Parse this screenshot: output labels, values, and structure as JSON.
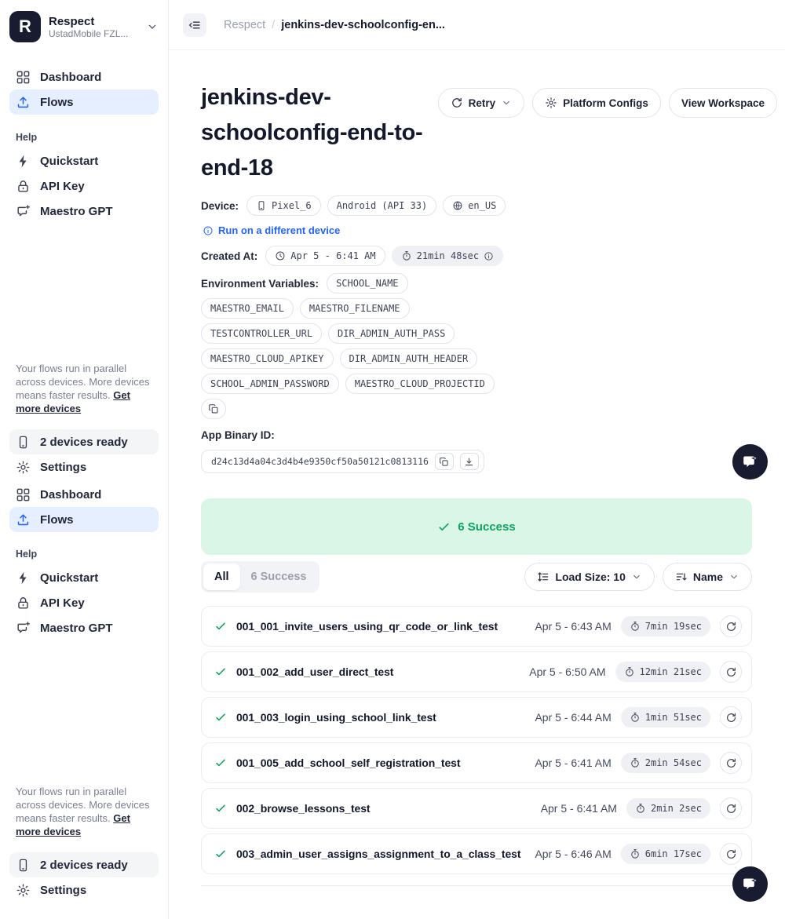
{
  "workspace": {
    "logo_letter": "R",
    "name": "Respect",
    "org": "UstadMobile FZL..."
  },
  "sidebar": {
    "dashboard": "Dashboard",
    "flows": "Flows",
    "help_label": "Help",
    "quickstart": "Quickstart",
    "api_key": "API Key",
    "maestro_gpt": "Maestro GPT",
    "promo_text": "Your flows run in parallel across devices. More devices means faster results.",
    "promo_link": "Get more devices",
    "devices_ready": "2 devices ready",
    "settings": "Settings"
  },
  "topbar": {
    "breadcrumb_root": "Respect",
    "breadcrumb_sep": "/",
    "breadcrumb_current": "jenkins-dev-schoolconfig-en..."
  },
  "header": {
    "title": "jenkins-dev-schoolconfig-end-to-end-18",
    "retry_label": "Retry",
    "platform_configs_label": "Platform Configs",
    "view_workspace_label": "View Workspace"
  },
  "details": {
    "device_label": "Device:",
    "device_model": "Pixel_6",
    "device_os": "Android (API 33)",
    "device_locale": "en_US",
    "run_different_device": "Run on a different device",
    "created_label": "Created At:",
    "created_time": "Apr 5 - 6:41 AM",
    "total_duration": "21min 48sec",
    "env_label": "Environment Variables:",
    "env_vars": [
      "SCHOOL_NAME",
      "MAESTRO_EMAIL",
      "MAESTRO_FILENAME",
      "TESTCONTROLLER_URL",
      "DIR_ADMIN_AUTH_PASS",
      "MAESTRO_CLOUD_APIKEY",
      "DIR_ADMIN_AUTH_HEADER",
      "SCHOOL_ADMIN_PASSWORD",
      "MAESTRO_CLOUD_PROJECTID"
    ],
    "binary_label": "App Binary ID:",
    "binary_id": "d24c13d4a04c3d4b4e9350cf50a50121c0813116"
  },
  "status": {
    "banner_text": "6 Success"
  },
  "filters": {
    "tab_all": "All",
    "tab_success": "6 Success",
    "load_size": "Load Size: 10",
    "sort": "Name"
  },
  "flows": [
    {
      "name": "001_001_invite_users_using_qr_code_or_link_test",
      "date": "Apr 5 - 6:43 AM",
      "duration": "7min 19sec"
    },
    {
      "name": "001_002_add_user_direct_test",
      "date": "Apr 5 - 6:50 AM",
      "duration": "12min 21sec"
    },
    {
      "name": "001_003_login_using_school_link_test",
      "date": "Apr 5 - 6:44 AM",
      "duration": "1min 51sec"
    },
    {
      "name": "001_005_add_school_self_registration_test",
      "date": "Apr 5 - 6:41 AM",
      "duration": "2min 54sec"
    },
    {
      "name": "002_browse_lessons_test",
      "date": "Apr 5 - 6:41 AM",
      "duration": "2min 2sec"
    },
    {
      "name": "003_admin_user_assigns_assignment_to_a_class_test",
      "date": "Apr 5 - 6:46 AM",
      "duration": "6min 17sec"
    }
  ],
  "colors": {
    "accent_blue": "#2265fd",
    "success_green": "#0ea35f",
    "success_bg": "#d9f6e6",
    "dark_navy": "#191b30",
    "active_item_bg": "#e6efff"
  }
}
